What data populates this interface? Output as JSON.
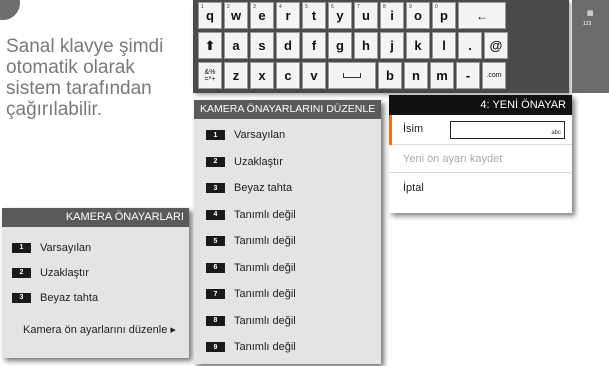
{
  "caption": "Sanal klavye şimdi otomatik olarak sistem tarafından çağırılabilir.",
  "keyboard": {
    "rows": [
      [
        {
          "k": "q",
          "n": "1"
        },
        {
          "k": "w",
          "n": "2"
        },
        {
          "k": "e",
          "n": "3"
        },
        {
          "k": "r",
          "n": "4"
        },
        {
          "k": "t",
          "n": "5"
        },
        {
          "k": "y",
          "n": "6"
        },
        {
          "k": "u",
          "n": "7"
        },
        {
          "k": "i",
          "n": "8"
        },
        {
          "k": "o",
          "n": "9"
        },
        {
          "k": "p",
          "n": "0"
        },
        {
          "k": "←",
          "wide": true
        }
      ],
      [
        {
          "k": "⬆",
          "dark": false
        },
        {
          "k": "a"
        },
        {
          "k": "s"
        },
        {
          "k": "d"
        },
        {
          "k": "f"
        },
        {
          "k": "g"
        },
        {
          "k": "h"
        },
        {
          "k": "j"
        },
        {
          "k": "k"
        },
        {
          "k": "l"
        },
        {
          "k": "."
        },
        {
          "k": "@"
        }
      ],
      [
        {
          "k": "&%\n=*+",
          "small": true
        },
        {
          "k": "z"
        },
        {
          "k": "x"
        },
        {
          "k": "c"
        },
        {
          "k": "v"
        },
        {
          "k": "space",
          "space": true
        },
        {
          "k": "b"
        },
        {
          "k": "n"
        },
        {
          "k": "m"
        },
        {
          "k": "-"
        },
        {
          "k": ".com",
          "small": true
        }
      ]
    ],
    "side_icon": "grid-icon",
    "side_label": "123"
  },
  "left_panel": {
    "title": "KAMERA ÖNAYARLARI",
    "items": [
      {
        "num": "1",
        "label": "Varsayılan"
      },
      {
        "num": "2",
        "label": "Uzaklaştır"
      },
      {
        "num": "3",
        "label": "Beyaz tahta"
      }
    ],
    "edit_label": "Kamera ön ayarlarını düzenle ▸"
  },
  "edit_panel": {
    "title": "KAMERA ÖNAYARLARINI DÜZENLE",
    "items": [
      {
        "num": "1",
        "label": "Varsayılan"
      },
      {
        "num": "2",
        "label": "Uzaklaştır"
      },
      {
        "num": "3",
        "label": "Beyaz tahta"
      },
      {
        "num": "4",
        "label": "Tanımlı değil"
      },
      {
        "num": "5",
        "label": "Tanımlı değil"
      },
      {
        "num": "6",
        "label": "Tanımlı değil"
      },
      {
        "num": "7",
        "label": "Tanımlı değil"
      },
      {
        "num": "8",
        "label": "Tanımlı değil"
      },
      {
        "num": "9",
        "label": "Tanımlı değil"
      }
    ]
  },
  "new_preset": {
    "title": "4: YENİ ÖNAYAR",
    "name_label": "İsim",
    "name_hint": "abc",
    "save_label": "Yeni ön ayarı kaydet",
    "cancel_label": "İptal"
  },
  "colors": {
    "accent": "#e8731c",
    "panel_header": "#5a5a5a",
    "dark_header": "#111111"
  }
}
